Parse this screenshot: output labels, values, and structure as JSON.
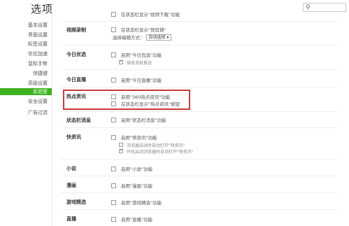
{
  "header": {
    "title": "选项",
    "search_icon": "search-icon",
    "search_placeholder": ""
  },
  "sidebar": {
    "items": [
      {
        "label": "基本设置"
      },
      {
        "label": "界面设置"
      },
      {
        "label": "标签设置"
      },
      {
        "label": "优化加速"
      },
      {
        "label": "鼠标手势"
      },
      {
        "label": "快捷键"
      },
      {
        "label": "高级设置"
      },
      {
        "label": "实验室",
        "active": true
      },
      {
        "label": "安全设置"
      },
      {
        "label": "广告过滤"
      }
    ]
  },
  "settings": {
    "top_partial": "在状态栏显示\"视频下载\"功能",
    "video_record": {
      "label": "视频录制",
      "option": "在状态栏显示\"快剪辑\"",
      "mode_label": "选择编辑方式：",
      "mode_value": "自动选择 ▾"
    },
    "today_pick": {
      "label": "今日优选",
      "option": "启用\"今日优选\"功能",
      "sub": "接收消息推送"
    },
    "today_live": {
      "label": "今日直播",
      "option": "启用\"今日直播\"功能"
    },
    "hot_news": {
      "label": "热点资讯",
      "option1": "启用\"360热点资讯\"功能",
      "option2": "在状态栏显示\"热点资讯\"按钮"
    },
    "status_msg": {
      "label": "状态栏消息",
      "option": "启用\"状态栏消息\"功能"
    },
    "kuaizixun": {
      "label": "快资讯",
      "option": "启用\"快资讯\"功能",
      "sub1": "浏览器启动时自动打开\"快资讯\"",
      "sub2": "开机启动浏览器时自动打开\"快资讯\""
    },
    "novel": {
      "label": "小说",
      "option": "启用\"小说\"功能"
    },
    "comic": {
      "label": "漫画",
      "option": "启用\"漫画\"功能"
    },
    "games": {
      "label": "游戏精选",
      "option": "启用\"游戏精选\"功能"
    },
    "live": {
      "label": "直播",
      "option": "启用\"直播\"功能"
    }
  },
  "colors": {
    "accent": "#3db31f",
    "highlight": "#c93a3a"
  }
}
